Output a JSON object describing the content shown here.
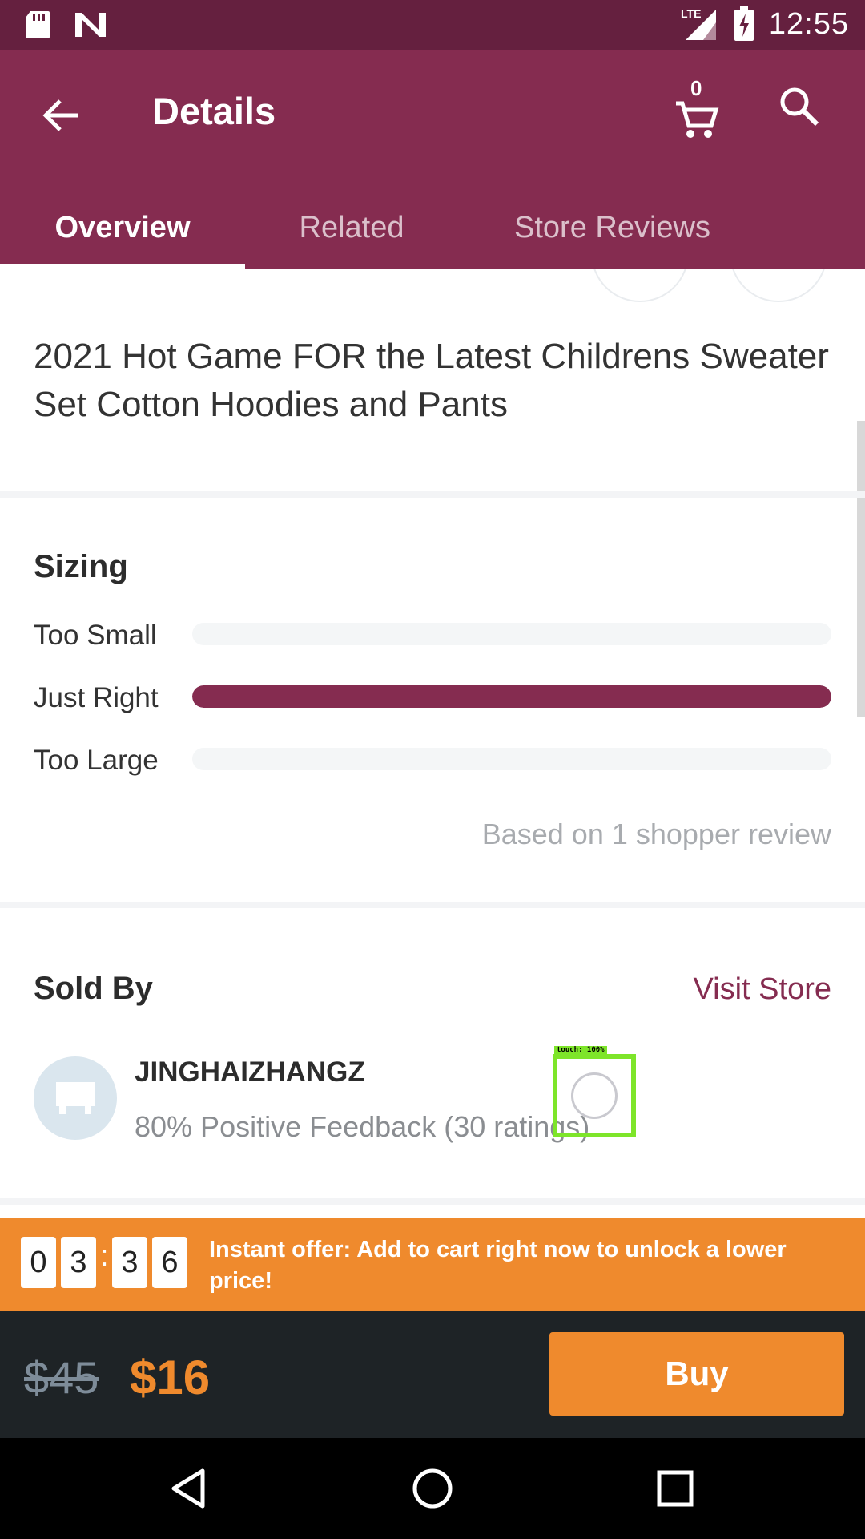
{
  "status_bar": {
    "time": "12:55",
    "network_label": "LTE",
    "icons": [
      "sd-card-icon",
      "n-notification-icon",
      "signal-icon",
      "battery-charging-icon"
    ]
  },
  "header": {
    "title": "Details",
    "cart_count": "0"
  },
  "tabs": [
    {
      "label": "Overview",
      "active": true
    },
    {
      "label": "Related",
      "active": false
    },
    {
      "label": "Store Reviews",
      "active": false
    }
  ],
  "product": {
    "title": "2021 Hot Game FOR the Latest Childrens Sweater Set Cotton Hoodies and Pants"
  },
  "sizing": {
    "title": "Sizing",
    "rows": [
      {
        "label": "Too Small",
        "fraction": 0
      },
      {
        "label": "Just Right",
        "fraction": 1
      },
      {
        "label": "Too Large",
        "fraction": 0
      }
    ],
    "based_on": "Based on 1 shopper review"
  },
  "sold_by": {
    "title": "Sold By",
    "visit_store": "Visit Store",
    "store_name": "JINGHAIZHANGZ",
    "feedback": "80% Positive Feedback (30 ratings)"
  },
  "touch_overlay": {
    "label": "touch: 100%"
  },
  "offer": {
    "countdown": [
      "0",
      "3",
      "3",
      "6"
    ],
    "separator": ":",
    "text": "Instant offer: Add to cart right now to unlock a lower price!"
  },
  "buy_bar": {
    "old_price": "$45",
    "new_price": "$16",
    "buy_label": "Buy"
  },
  "colors": {
    "brand": "#852c50",
    "status_bar": "#65203f",
    "accent": "#ef8a2d",
    "bar_bg": "#1e2326"
  }
}
